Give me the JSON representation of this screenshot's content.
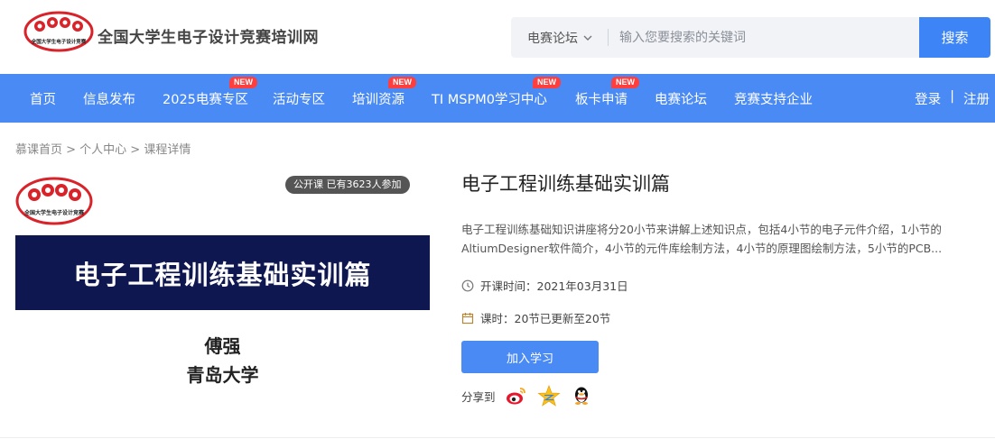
{
  "header": {
    "site_name": "全国大学生电子设计竞赛培训网",
    "logo_text": "全国大学生电子设计竞赛",
    "search": {
      "category": "电赛论坛",
      "placeholder": "输入您要搜索的关键词",
      "button": "搜索"
    }
  },
  "nav": {
    "items": [
      {
        "label": "首页",
        "badge": ""
      },
      {
        "label": "信息发布",
        "badge": ""
      },
      {
        "label": "2025电赛专区",
        "badge": "NEW"
      },
      {
        "label": "活动专区",
        "badge": ""
      },
      {
        "label": "培训资源",
        "badge": "NEW"
      },
      {
        "label": "TI MSPM0学习中心",
        "badge": "NEW"
      },
      {
        "label": "板卡申请",
        "badge": "NEW"
      },
      {
        "label": "电赛论坛",
        "badge": ""
      },
      {
        "label": "竞赛支持企业",
        "badge": ""
      }
    ],
    "login": "登录",
    "separator": "|",
    "register": "注册"
  },
  "breadcrumb": "慕课首页 > 个人中心 > 课程详情",
  "cover": {
    "badge": "公开课   已有3623人参加",
    "title": "电子工程训练基础实训篇",
    "author": "傅强",
    "school": "青岛大学"
  },
  "course": {
    "title": "电子工程训练基础实训篇",
    "description": "电子工程训练基础知识讲座将分20小节来讲解上述知识点，包括4小节的电子元件介绍，1小节的AltiumDesigner软件简介，4小节的元件库绘制方法，4小节的原理图绘制方法，5小节的PCB...",
    "start_time": "开课时间：2021年03月31日",
    "lessons": "课时：20节已更新至20节",
    "join_button": "加入学习",
    "share_label": "分享到"
  },
  "colors": {
    "primary": "#4a8af4",
    "badge_red": "#ff3e3e",
    "cover_band": "#0f1750"
  }
}
